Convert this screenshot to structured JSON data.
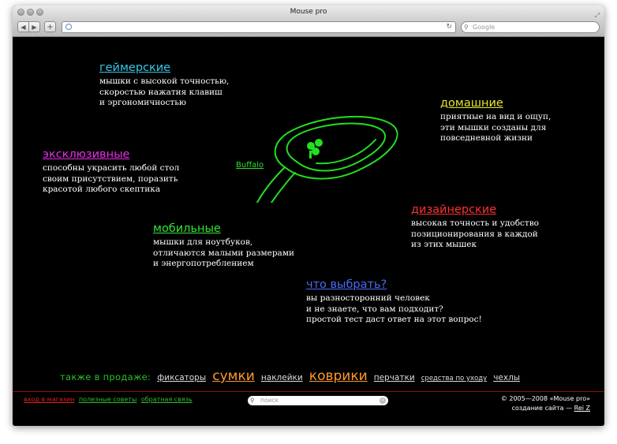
{
  "window": {
    "title": "Mouse pro"
  },
  "toolbar": {
    "back_icon": "◀",
    "forward_icon": "▶",
    "add_icon": "+",
    "reload_icon": "↻",
    "search_placeholder": "Google"
  },
  "colors": {
    "gamer": "#33c8e8",
    "home": "#e6e62e",
    "exclusive": "#e62ee6",
    "designer": "#ff3030",
    "mobile": "#32e632",
    "choose": "#4a6cf5",
    "mouse": "#22e022"
  },
  "categories": {
    "gamer": {
      "title": "геймерские",
      "text": "мышки с высокой точностью,\nскоростью нажатия клавиш\nи эргономичностью"
    },
    "home": {
      "title": "домашние",
      "text": "приятные на вид и ощуп,\nэти мышки созданы для\nповседневной жизни"
    },
    "exclusive": {
      "title": "эксклюзивные",
      "text": "способны украсить любой стол\nсвоим присутствием, поразить\nкрасотой любого скептика"
    },
    "designer": {
      "title": "дизайнерские",
      "text": "высокая точность и удобство\nпозиционирования в каждой\nиз этих мышек"
    },
    "mobile": {
      "title": "мобильные",
      "text": "мышки для ноутбуков,\nотличаются малыми размерами\nи энергопотреблением"
    },
    "choose": {
      "title": "что выбрать?",
      "text": "вы разносторонний человек\nи не знаете, что вам подходит?\nпростой тест даст ответ на этот вопрос!"
    }
  },
  "mouse_label": "Buffalo",
  "also": {
    "prefix": "также в продаже:",
    "items": [
      "фиксаторы",
      "сумки",
      "наклейки",
      "коврики",
      "перчатки",
      "средства по уходу",
      "чехлы"
    ]
  },
  "footer": {
    "links": [
      "вход в магазин",
      "полезные советы",
      "обратная связь"
    ],
    "link_colors": [
      "#e01e1e",
      "#2fbf2f",
      "#2fbf2f"
    ],
    "search_placeholder": "поиск",
    "copyright": "© 2005—2008 «Mouse pro»",
    "credit_prefix": "создание сайта — ",
    "credit_name": "Rei Z"
  }
}
